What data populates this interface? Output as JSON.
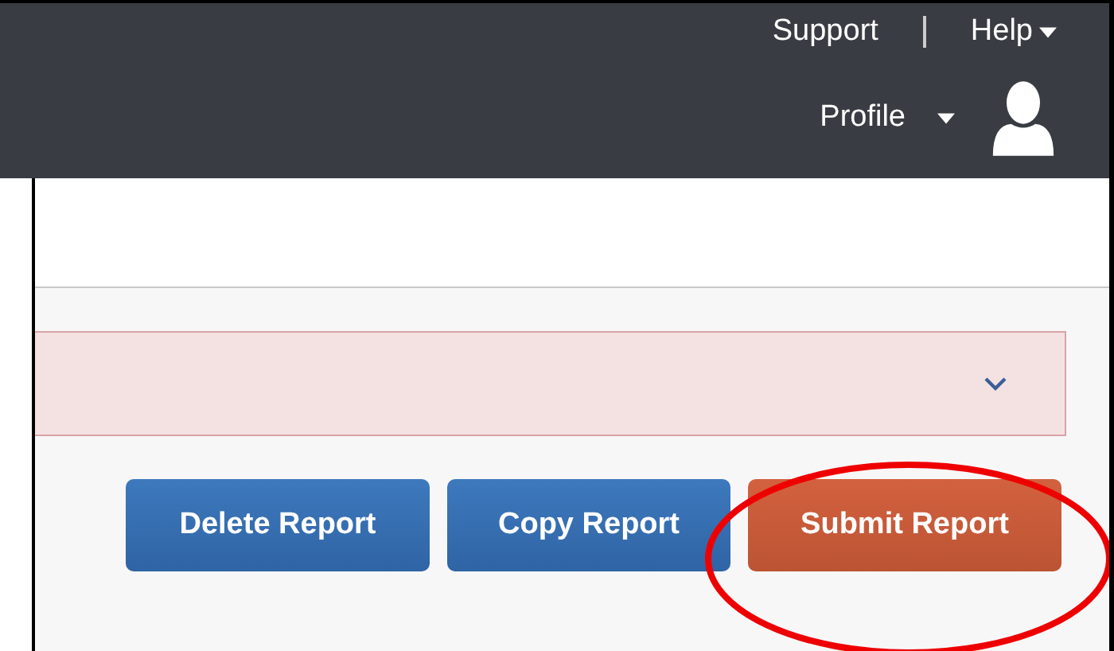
{
  "header": {
    "links": [
      {
        "label": "Support",
        "dropdown": false
      },
      {
        "label": "Help",
        "dropdown": true
      }
    ],
    "profile": {
      "label": "Profile",
      "dropdown": true
    }
  },
  "alert": {
    "expanded": false
  },
  "buttons": [
    {
      "label": "Delete Report",
      "kind": "secondary"
    },
    {
      "label": "Copy Report",
      "kind": "secondary"
    },
    {
      "label": "Submit Report",
      "kind": "primary"
    }
  ],
  "annotation": {
    "kind": "ellipse"
  }
}
